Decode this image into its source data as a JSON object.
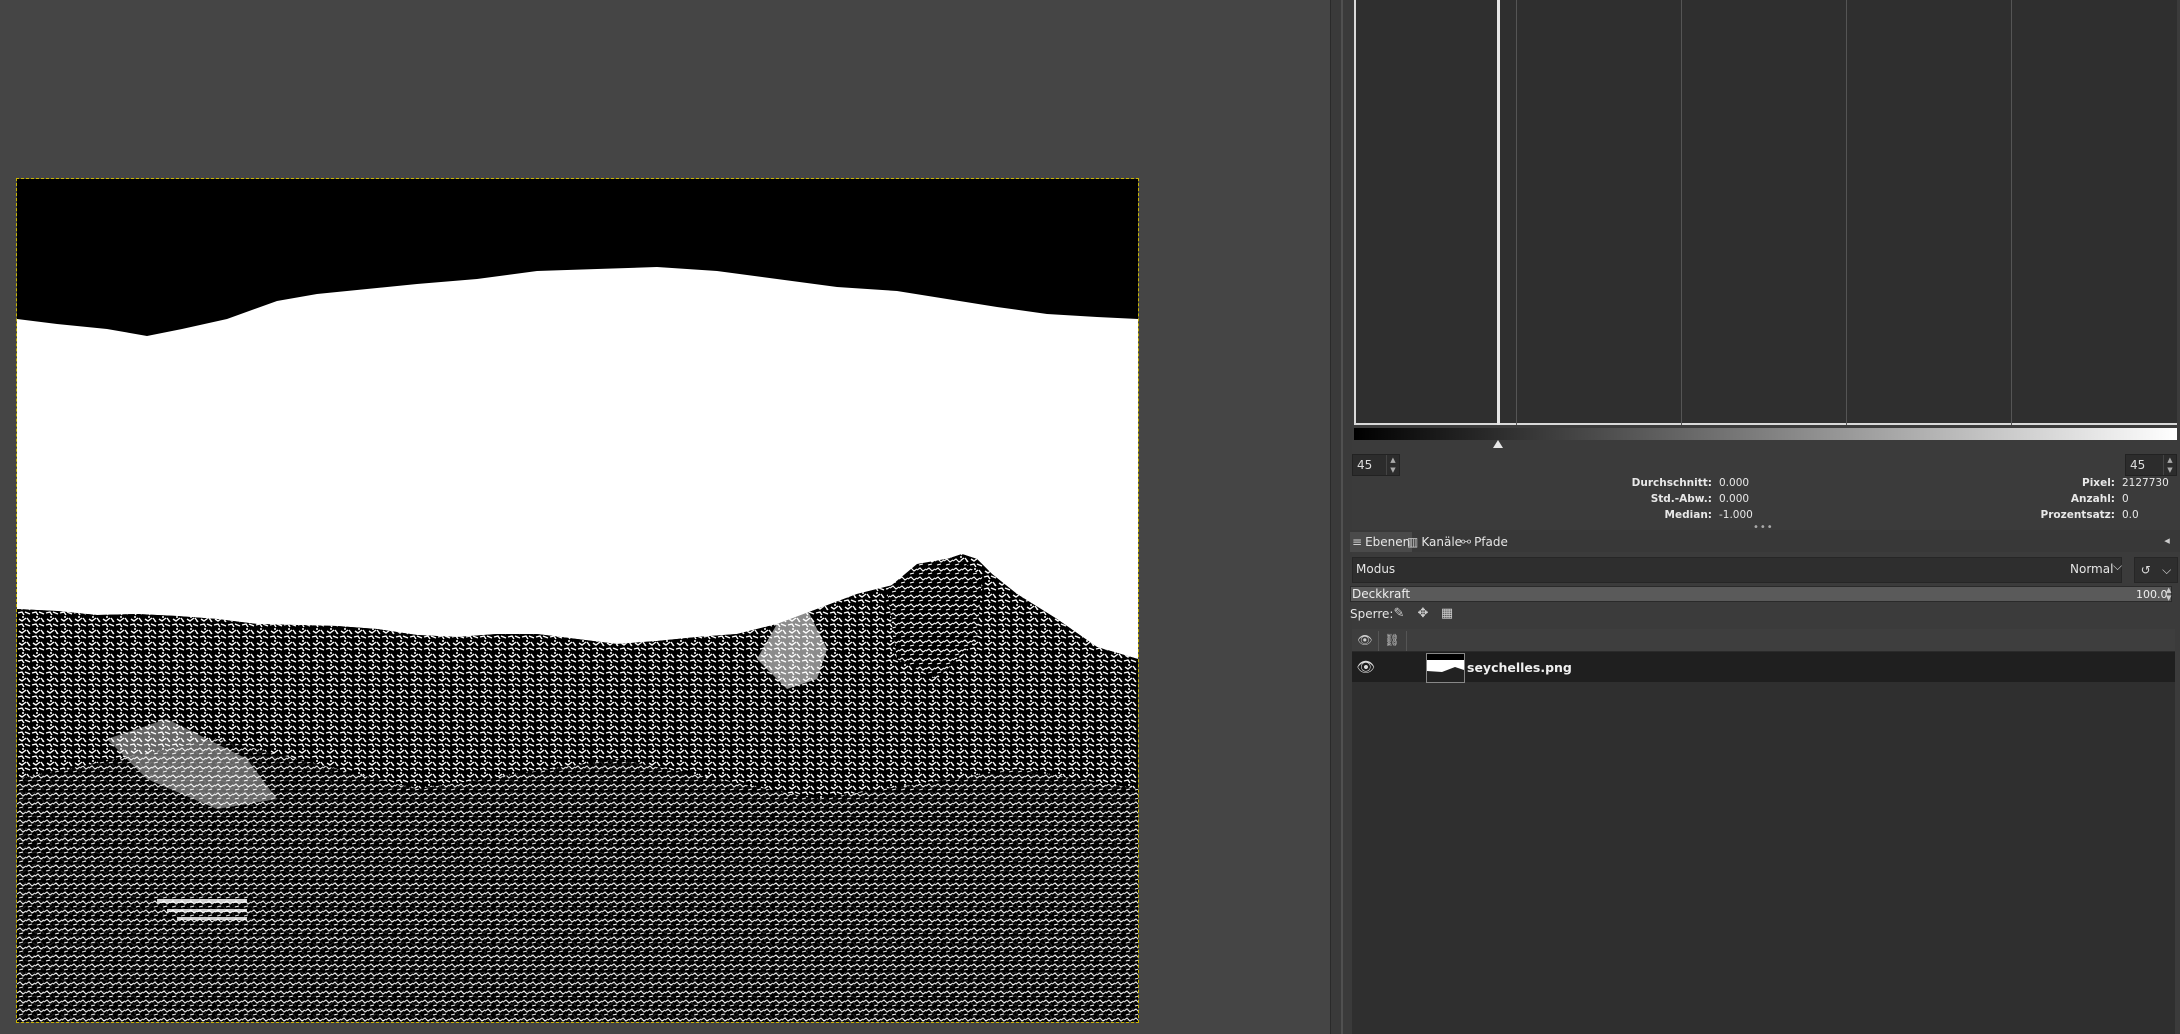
{
  "canvas": {
    "image_name": "seychelles.png"
  },
  "histogram": {
    "range_low": "45",
    "range_high": "45",
    "stats_left": [
      {
        "label": "Durchschnitt:",
        "value": "0.000"
      },
      {
        "label": "Std.-Abw.:",
        "value": "0.000"
      },
      {
        "label": "Median:",
        "value": "-1.000"
      }
    ],
    "stats_right": [
      {
        "label": "Pixel:",
        "value": "2127730"
      },
      {
        "label": "Anzahl:",
        "value": "0"
      },
      {
        "label": "Prozentsatz:",
        "value": "0.0"
      }
    ]
  },
  "tabs": [
    {
      "label": "Ebenen",
      "icon": "layers-icon"
    },
    {
      "label": "Kanäle",
      "icon": "channels-icon"
    },
    {
      "label": "Pfade",
      "icon": "paths-icon"
    }
  ],
  "layers_panel": {
    "mode_label": "Modus",
    "mode_value": "Normal",
    "opacity_label": "Deckkraft",
    "opacity_value": "100.0",
    "lock_label": "Sperre:",
    "layers": [
      {
        "name": "seychelles.png",
        "visible": true
      }
    ]
  }
}
